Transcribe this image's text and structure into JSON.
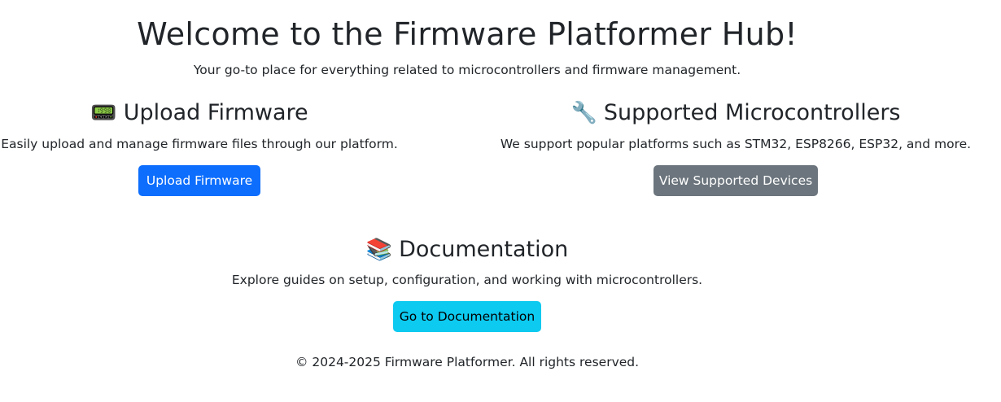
{
  "header": {
    "title": "Welcome to the Firmware Platformer Hub!",
    "subtitle": "Your go-to place for everything related to microcontrollers and firmware management."
  },
  "cards": {
    "upload": {
      "icon": "pager-icon",
      "emoji": "📟",
      "title": "Upload Firmware",
      "description": "Easily upload and manage firmware files through our platform.",
      "button_label": "Upload Firmware",
      "button_color": "#0d6efd"
    },
    "supported": {
      "icon": "wrench-icon",
      "emoji": "🔧",
      "title": "Supported Microcontrollers",
      "description": "We support popular platforms such as STM32, ESP8266, ESP32, and more.",
      "button_label": "View Supported Devices",
      "button_color": "#6c757d"
    },
    "docs": {
      "icon": "books-icon",
      "emoji": "📚",
      "title": "Documentation",
      "description": "Explore guides on setup, configuration, and working with microcontrollers.",
      "button_label": "Go to Documentation",
      "button_color": "#0dcaf0"
    }
  },
  "footer": {
    "text": "© 2024-2025 Firmware Platformer. All rights reserved."
  }
}
